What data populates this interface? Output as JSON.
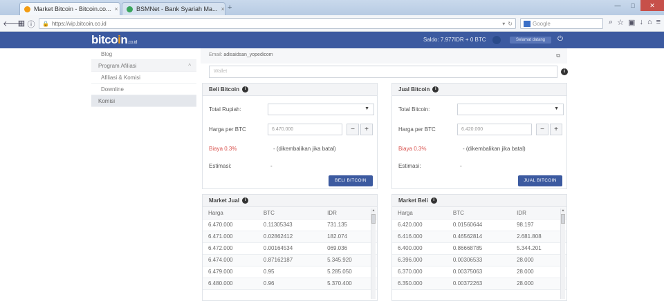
{
  "browser": {
    "tabs": [
      {
        "title": "Market Bitcoin - Bitcoin.co...",
        "favicon_color": "#f39c12",
        "close": "×"
      },
      {
        "title": "BSMNet - Bank Syariah Ma...",
        "favicon_color": "#3aa55c",
        "close": "×"
      }
    ],
    "new_tab": "+",
    "window_buttons": {
      "minimize": "—",
      "maximize": "□",
      "close": "✕"
    },
    "url": "https://vip.bitcoin.co.id",
    "search_placeholder": "Google"
  },
  "site": {
    "logo_text": "bitco",
    "logo_dot": "i",
    "logo_rest": "n",
    "logo_suffix": ".co.id",
    "saldo": "Saldo: 7.977IDR + 0 BTC",
    "user_label": "Selamat datang",
    "brand_color": "#3c5aa0"
  },
  "sidebar": {
    "items": [
      {
        "label": "Blog",
        "kind": "sub"
      },
      {
        "label": "Program Afiliasi",
        "kind": "parent",
        "chevron": "^"
      },
      {
        "label": "Afiliasi & Komisi",
        "kind": "sub"
      },
      {
        "label": "Downline",
        "kind": "sub"
      },
      {
        "label": "Komisi",
        "kind": "active"
      }
    ]
  },
  "main": {
    "email_label": "Email:",
    "email_value": "adisaidsan_yopedicom",
    "wide_input_placeholder": "Wallet"
  },
  "buy": {
    "title": "Beli Bitcoin",
    "total_label": "Total Rupiah:",
    "price_label": "Harga per BTC",
    "price_value": "6.470.000",
    "fee_label": "Biaya 0.3%",
    "fee_desc": "- (dikembalikan jika batal)",
    "estimate_label": "Estimasi:",
    "estimate_value": "-",
    "button": "BELI BITCOIN"
  },
  "sell": {
    "title": "Jual Bitcoin",
    "total_label": "Total Bitcoin:",
    "price_label": "Harga per BTC",
    "price_value": "6.420.000",
    "fee_label": "Biaya 0.3%",
    "fee_desc": "- (dikembalikan jika batal)",
    "estimate_label": "Estimasi:",
    "estimate_value": "-",
    "button": "JUAL BITCOIN"
  },
  "market_sell": {
    "title": "Market Jual",
    "columns": [
      "Harga",
      "BTC",
      "IDR"
    ],
    "rows": [
      [
        "6.470.000",
        "0.11305343",
        "731.135"
      ],
      [
        "6.471.000",
        "0.02862412",
        "182.074"
      ],
      [
        "6.472.000",
        "0.00164534",
        "069.036"
      ],
      [
        "6.474.000",
        "0.87162187",
        "5.345.920"
      ],
      [
        "6.479.000",
        "0.95",
        "5.285.050"
      ],
      [
        "6.480.000",
        "0.96",
        "5.370.400"
      ]
    ]
  },
  "market_buy": {
    "title": "Market Beli",
    "columns": [
      "Harga",
      "BTC",
      "IDR"
    ],
    "rows": [
      [
        "6.420.000",
        "0.01560644",
        "98.197"
      ],
      [
        "6.416.000",
        "0.46562814",
        "2.681.808"
      ],
      [
        "6.400.000",
        "0.86668785",
        "5.344.201"
      ],
      [
        "6.396.000",
        "0.00306533",
        "28.000"
      ],
      [
        "6.370.000",
        "0.00375063",
        "28.000"
      ],
      [
        "6.350.000",
        "0.00372263",
        "28.000"
      ]
    ]
  },
  "icons": {
    "info": "i",
    "caret": "▼",
    "minus": "−",
    "plus": "+",
    "scroll_up": "▲"
  }
}
